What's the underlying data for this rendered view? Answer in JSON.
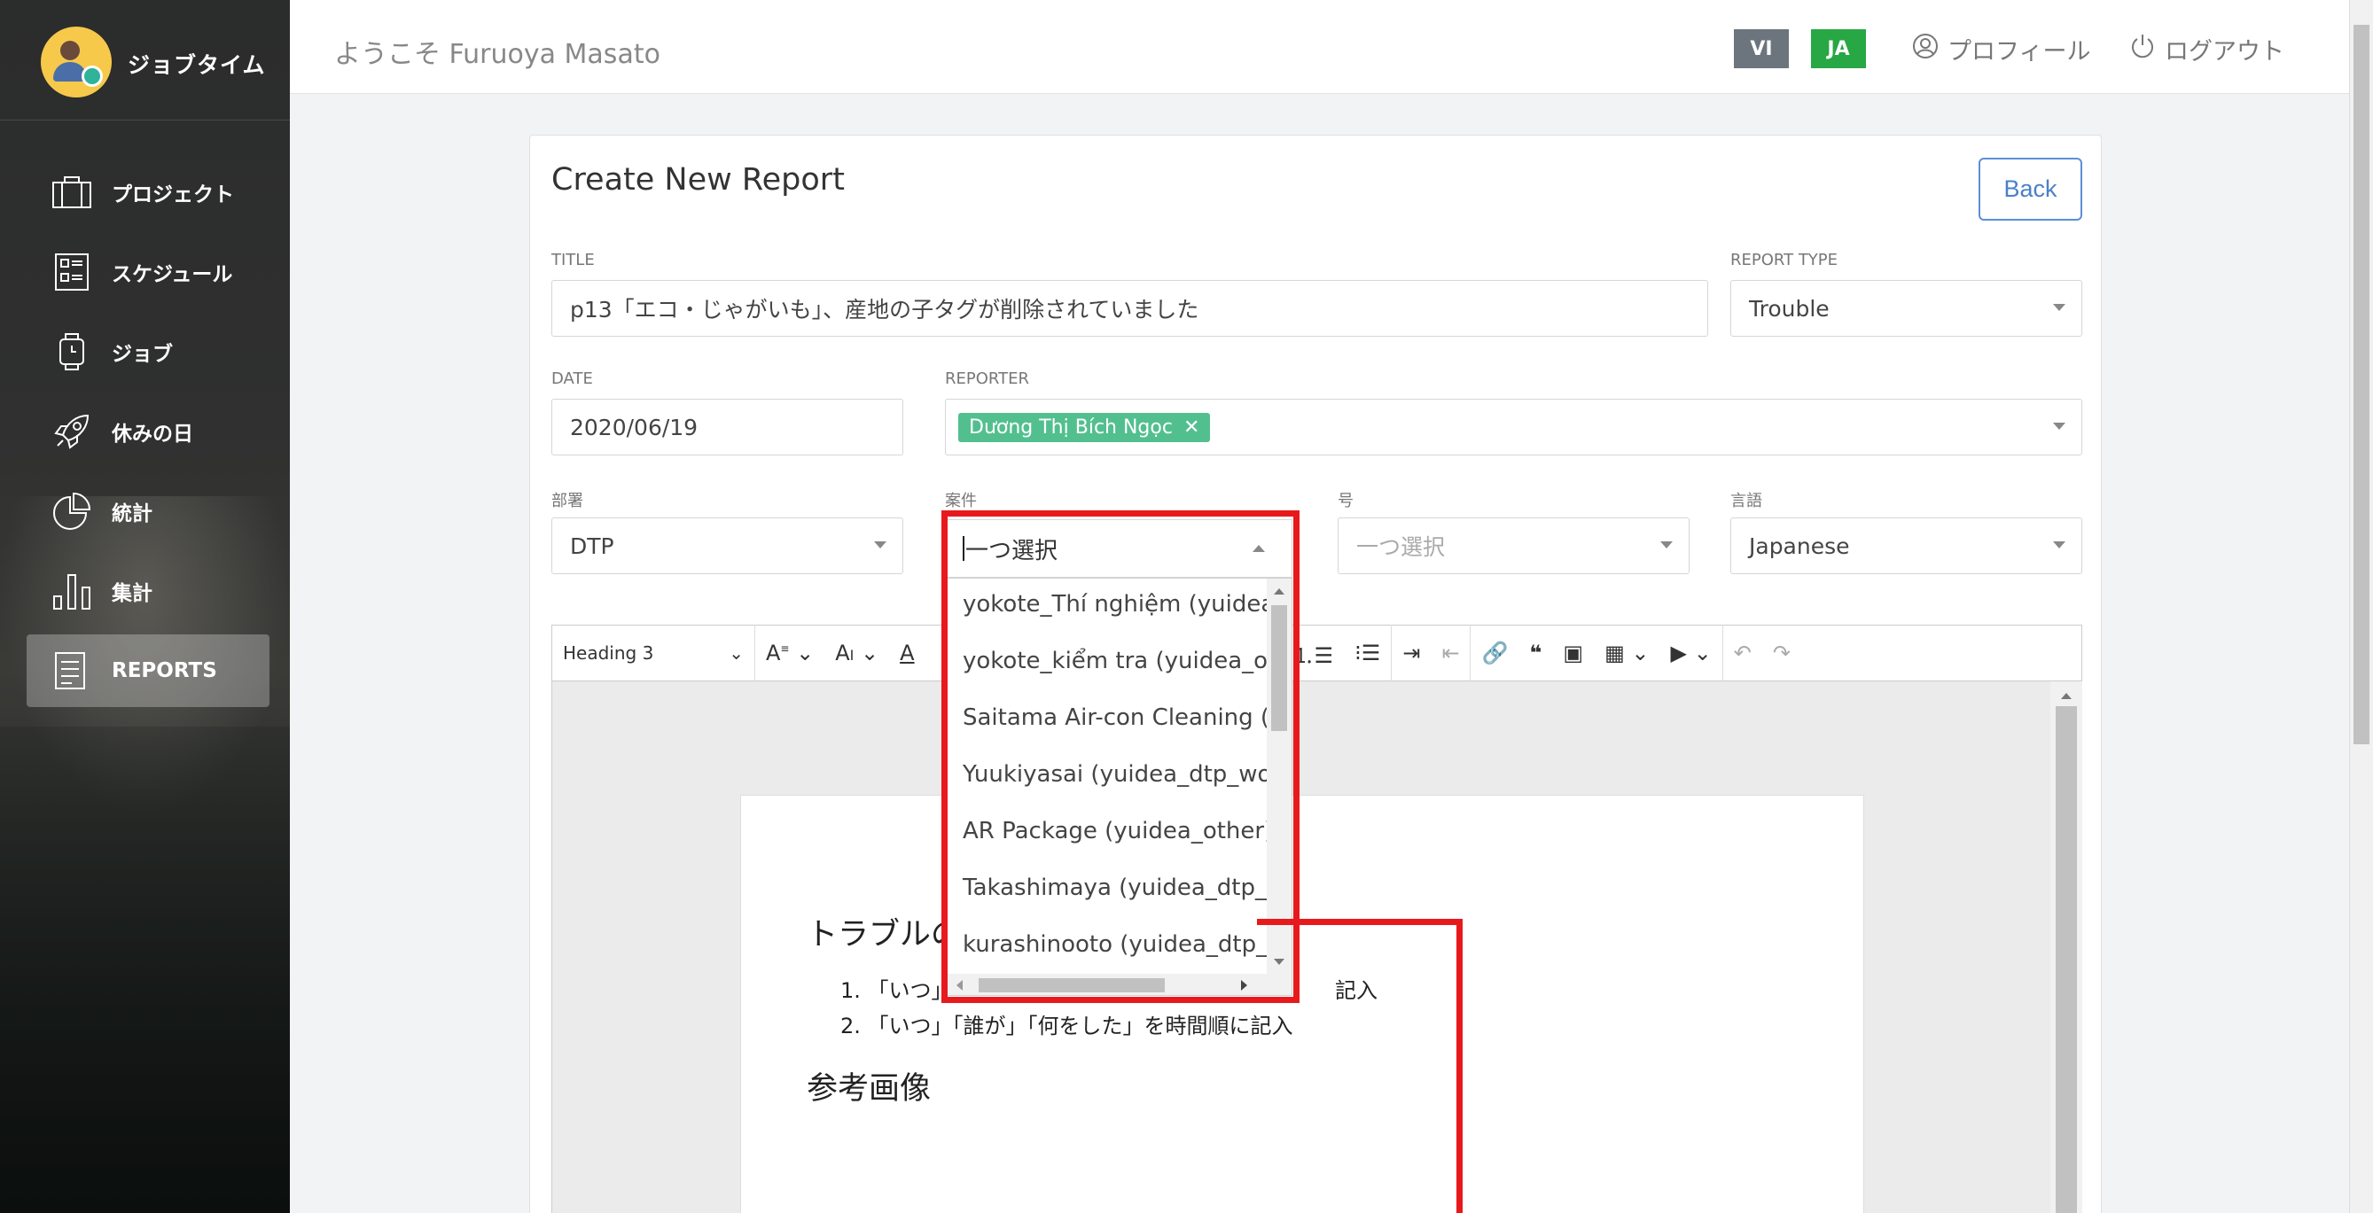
{
  "app": {
    "brand": "ジョブタイム"
  },
  "sidebar": {
    "items": [
      {
        "label": "プロジェクト",
        "icon": "briefcase-icon"
      },
      {
        "label": "スケジュール",
        "icon": "schedule-icon"
      },
      {
        "label": "ジョブ",
        "icon": "watch-icon"
      },
      {
        "label": "休みの日",
        "icon": "rocket-icon"
      },
      {
        "label": "統計",
        "icon": "pie-chart-icon"
      },
      {
        "label": "集計",
        "icon": "bar-chart-icon"
      },
      {
        "label": "REPORTS",
        "icon": "report-icon",
        "active": true
      }
    ]
  },
  "header": {
    "welcome": "ようこそ Furuoya Masato",
    "lang_vi": "VI",
    "lang_ja": "JA",
    "profile": "プロフィール",
    "logout": "ログアウト"
  },
  "form": {
    "title_heading": "Create New Report",
    "back": "Back",
    "title_label": "TITLE",
    "title_value": "p13「エコ・じゃがいも」、産地の子タグが削除されていました",
    "report_type_label": "REPORT TYPE",
    "report_type_value": "Trouble",
    "date_label": "DATE",
    "date_value": "2020/06/19",
    "reporter_label": "REPORTER",
    "reporter_tag": "Dương Thị Bích Ngọc",
    "department_label": "部署",
    "department_value": "DTP",
    "case_label": "案件",
    "case_placeholder": "一つ選択",
    "number_label": "号",
    "number_placeholder": "一つ選択",
    "language_label": "言語",
    "language_value": "Japanese"
  },
  "editor": {
    "heading_select": "Heading 3",
    "content": {
      "heading1": "トラブルの",
      "list": [
        "1. 「いつ」",
        "2. 「いつ」「誰が」「何をした」を時間順に記入"
      ],
      "list1_tail": "記入",
      "heading2": "参考画像"
    }
  },
  "dropdown": {
    "options": [
      "yokote_Thí nghiệm (yuidea_",
      "yokote_kiểm tra (yuidea_oth",
      "Saitama Air-con Cleaning (yu",
      "Yuukiyasai (yuidea_dtp_wor",
      "AR Package (yuidea_other)",
      "Takashimaya (yuidea_dtp_tr",
      "kurashinooto (yuidea_dtp_tr"
    ]
  },
  "colors": {
    "highlight": "#e8191c",
    "tag": "#52bf8f",
    "lang_active": "#28a745"
  }
}
